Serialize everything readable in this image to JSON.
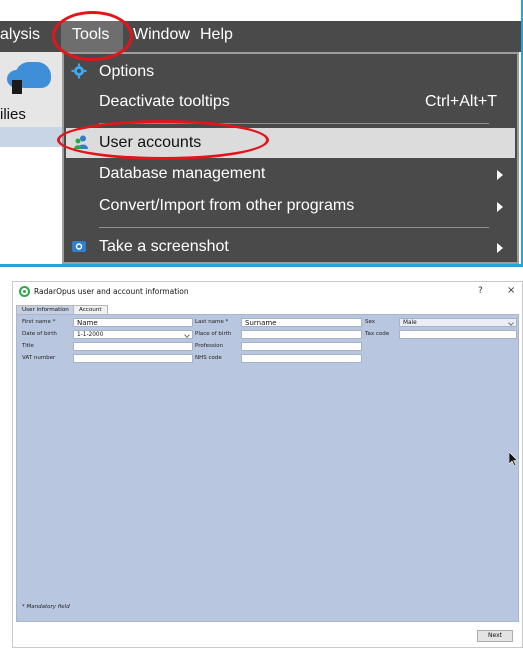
{
  "menubar": {
    "items": [
      {
        "label": "alysis"
      },
      {
        "label": "Tools"
      },
      {
        "label": "Window"
      },
      {
        "label": "Help"
      }
    ]
  },
  "ribbon": {
    "label": "ilies"
  },
  "tools_menu": {
    "items": [
      {
        "label": "Options",
        "icon": "gear-icon"
      },
      {
        "label": "Deactivate tooltips",
        "shortcut": "Ctrl+Alt+T"
      },
      {
        "label": "User accounts",
        "icon": "users-icon",
        "highlighted": true
      },
      {
        "label": "Database management",
        "submenu": true
      },
      {
        "label": "Convert/Import from other programs",
        "submenu": true
      },
      {
        "label": "Take a screenshot",
        "icon": "camera-icon",
        "submenu": true
      }
    ]
  },
  "dialog": {
    "title": "RadarOpus user and account information",
    "help": "?",
    "close": "×",
    "tabs": [
      {
        "label": "User information",
        "active": true
      },
      {
        "label": "Account",
        "active": false
      }
    ],
    "fields": {
      "first_name": {
        "label": "First name *",
        "value": "Name"
      },
      "last_name": {
        "label": "Last name *",
        "value": "Surname"
      },
      "sex": {
        "label": "Sex",
        "value": "Male"
      },
      "date_of_birth": {
        "label": "Date of birth",
        "value": "1-1-2000"
      },
      "place_of_birth": {
        "label": "Place of birth",
        "value": ""
      },
      "tax_code": {
        "label": "Tax code",
        "value": ""
      },
      "title": {
        "label": "Title",
        "value": ""
      },
      "profession": {
        "label": "Profession",
        "value": ""
      },
      "vat_number": {
        "label": "VAT number",
        "value": ""
      },
      "nhs_code": {
        "label": "NHS code",
        "value": ""
      }
    },
    "mandatory_note": "* Mandatory field",
    "next_label": "Next"
  },
  "colors": {
    "menubar": "#4a4a4a",
    "highlight_ring": "#e3151a",
    "dialog_panel": "#b9c6df",
    "accent_border": "#29a3d6"
  }
}
